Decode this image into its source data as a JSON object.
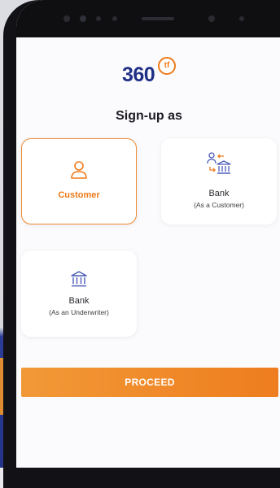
{
  "brand": {
    "logo_number": "360",
    "logo_badge": "tf"
  },
  "page": {
    "title": "Sign-up as"
  },
  "options": {
    "customer": {
      "label": "Customer",
      "icon": "user-icon",
      "selected": true
    },
    "bank_customer": {
      "label": "Bank",
      "sub": "(As a Customer)",
      "icon": "bank-exchange-icon"
    },
    "bank_underwriter": {
      "label": "Bank",
      "sub": "(As an Underwriter)",
      "icon": "bank-icon"
    }
  },
  "actions": {
    "proceed_label": "PROCEED"
  },
  "colors": {
    "accent": "#ee7a1a",
    "brand_blue": "#1f2f86",
    "bank_icon": "#4a5cb8"
  }
}
